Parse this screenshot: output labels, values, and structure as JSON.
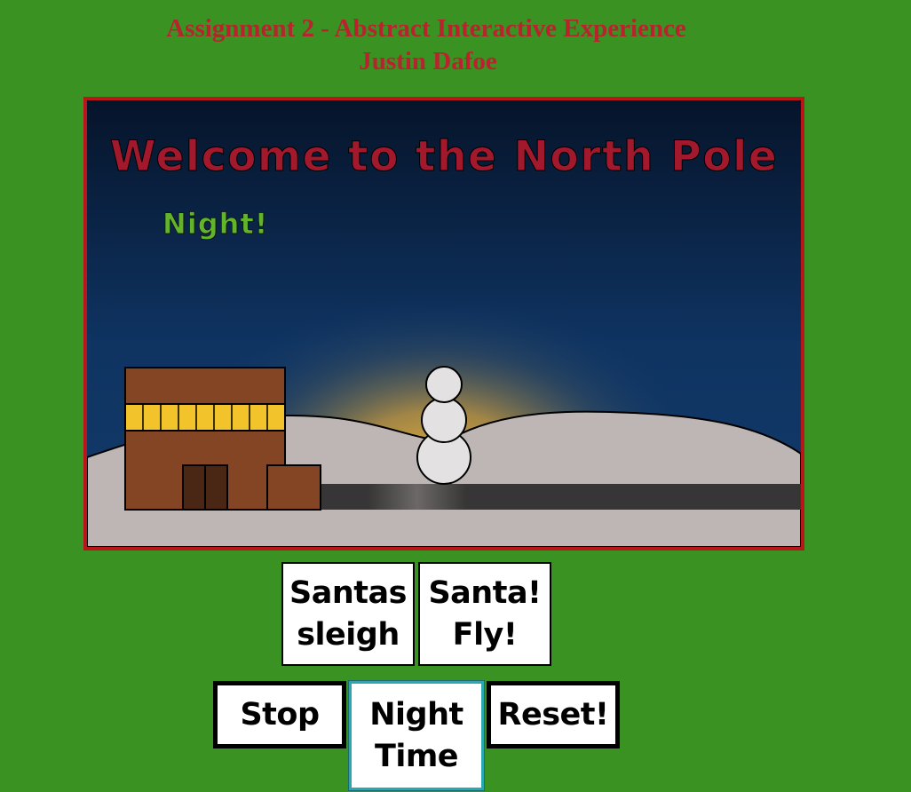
{
  "header": {
    "title": "Assignment 2 - Abstract Interactive Experience",
    "author": "Justin Dafoe"
  },
  "scene": {
    "welcome_text": "Welcome to the North Pole",
    "mode_text": "Night!",
    "colors": {
      "title": "#a2182c",
      "mode": "#62b52a",
      "sky_top": "#06142a",
      "sky_bottom": "#113a6a",
      "glow": "#e0b33c",
      "snow": "#beb5b5",
      "building": "#834524",
      "windows": "#f3c32c",
      "road": "#373535",
      "snowman": "#e3e1e1"
    }
  },
  "buttons": {
    "santas_sleigh": [
      "Santas",
      "sleigh"
    ],
    "santa_fly": [
      "Santa!",
      "Fly!"
    ],
    "stop": "Stop",
    "night_time": [
      "Night",
      "Time"
    ],
    "reset": "Reset!"
  }
}
